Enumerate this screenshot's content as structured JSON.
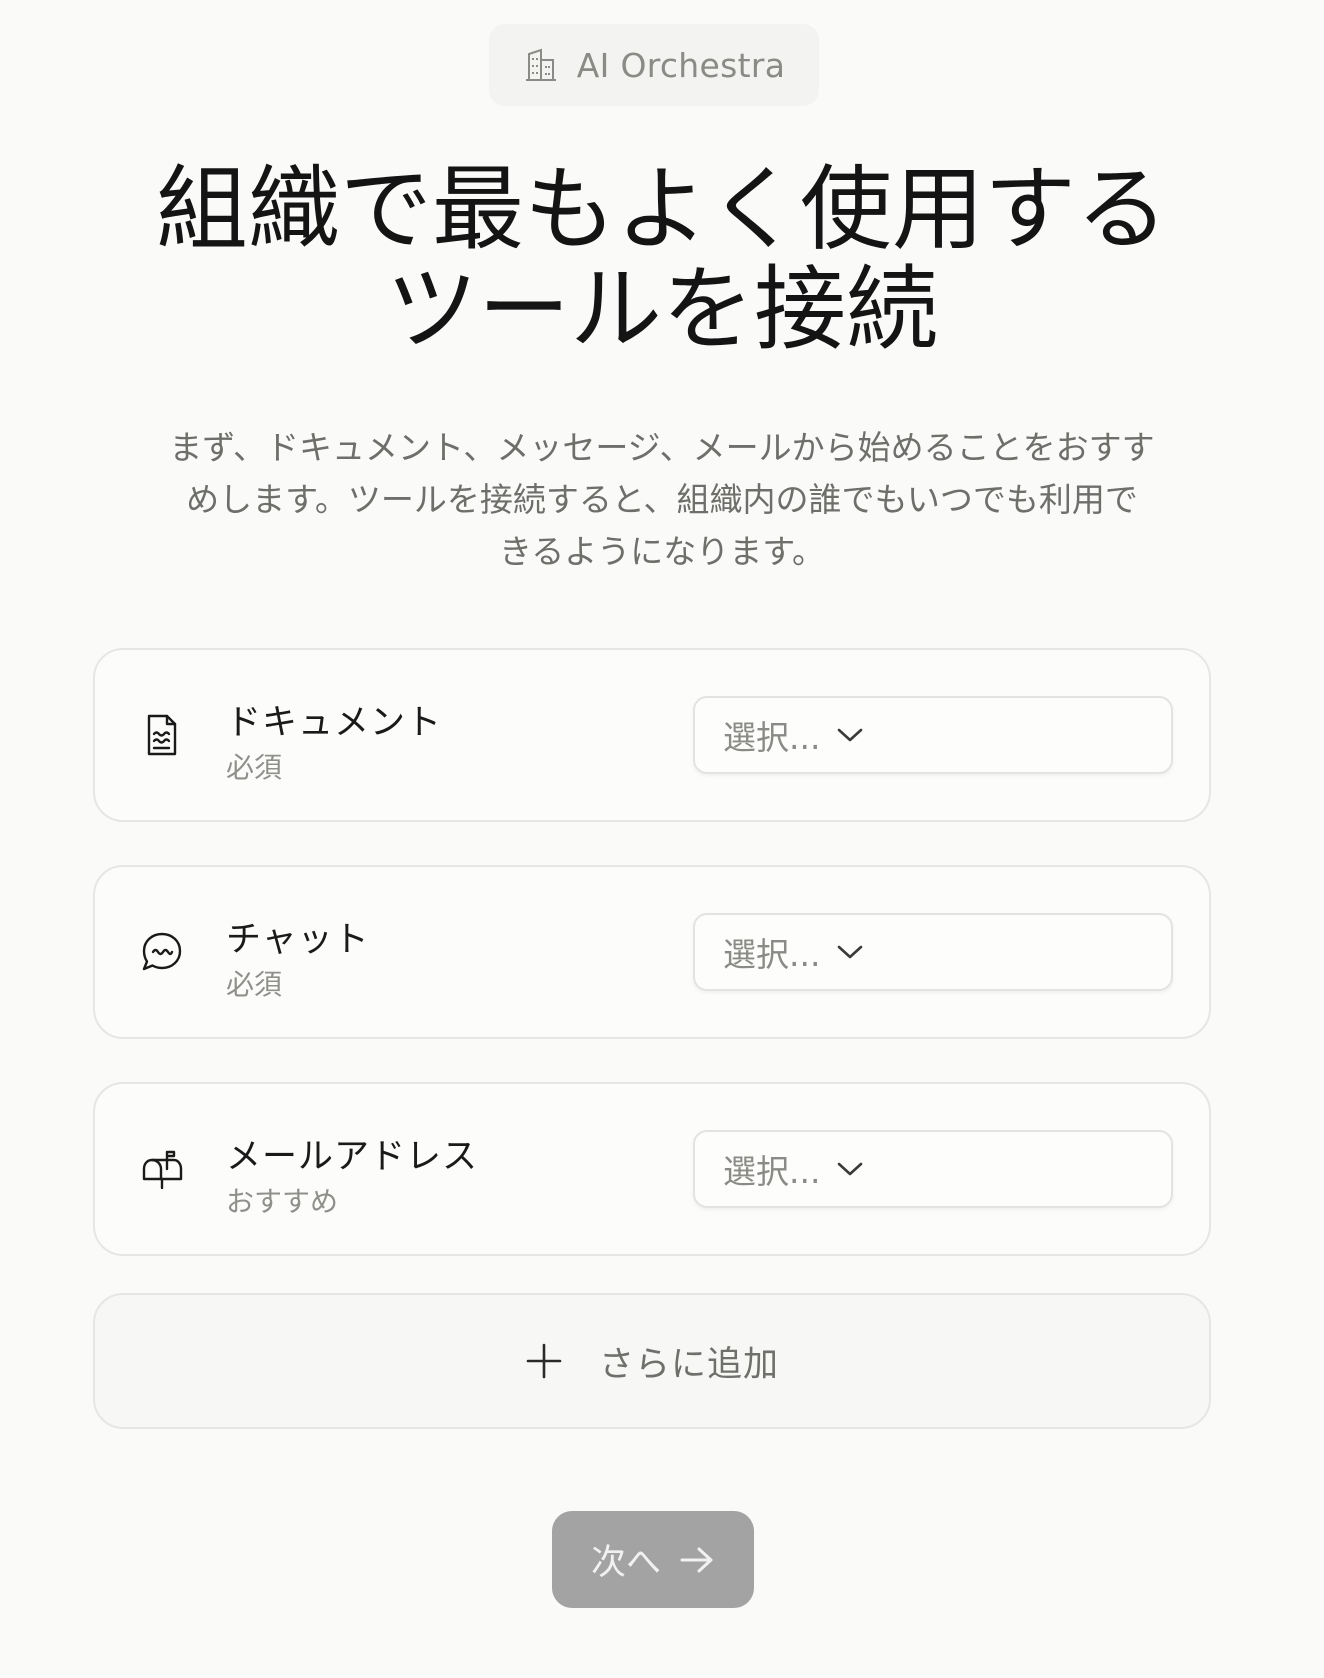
{
  "org": {
    "name": "AI Orchestra",
    "icon": "building-icon"
  },
  "page": {
    "title_line1": "組織で最もよく使用する",
    "title_line2": "ツールを接続",
    "subtitle_line1": "まず、ドキュメント、メッセージ、メールから始めることをおすす",
    "subtitle_line2": "めします。ツールを接続すると、組織内の誰でもいつでも利用で",
    "subtitle_line3": "きるようになります。"
  },
  "tools": [
    {
      "name": "ドキュメント",
      "requirement": "必須",
      "icon": "document-icon",
      "select_placeholder": "選択..."
    },
    {
      "name": "チャット",
      "requirement": "必須",
      "icon": "chat-icon",
      "select_placeholder": "選択..."
    },
    {
      "name": "メールアドレス",
      "requirement": "おすすめ",
      "icon": "mailbox-icon",
      "select_placeholder": "選択..."
    }
  ],
  "add_more": {
    "label": "さらに追加",
    "icon": "plus-icon"
  },
  "next_button": {
    "label": "次へ",
    "icon": "arrow-right-icon",
    "enabled": false
  },
  "colors": {
    "background": "#fafaf9",
    "card_border": "#e6e6e3",
    "button_disabled": "#a3a3a3",
    "muted_text": "#8a8a86"
  }
}
